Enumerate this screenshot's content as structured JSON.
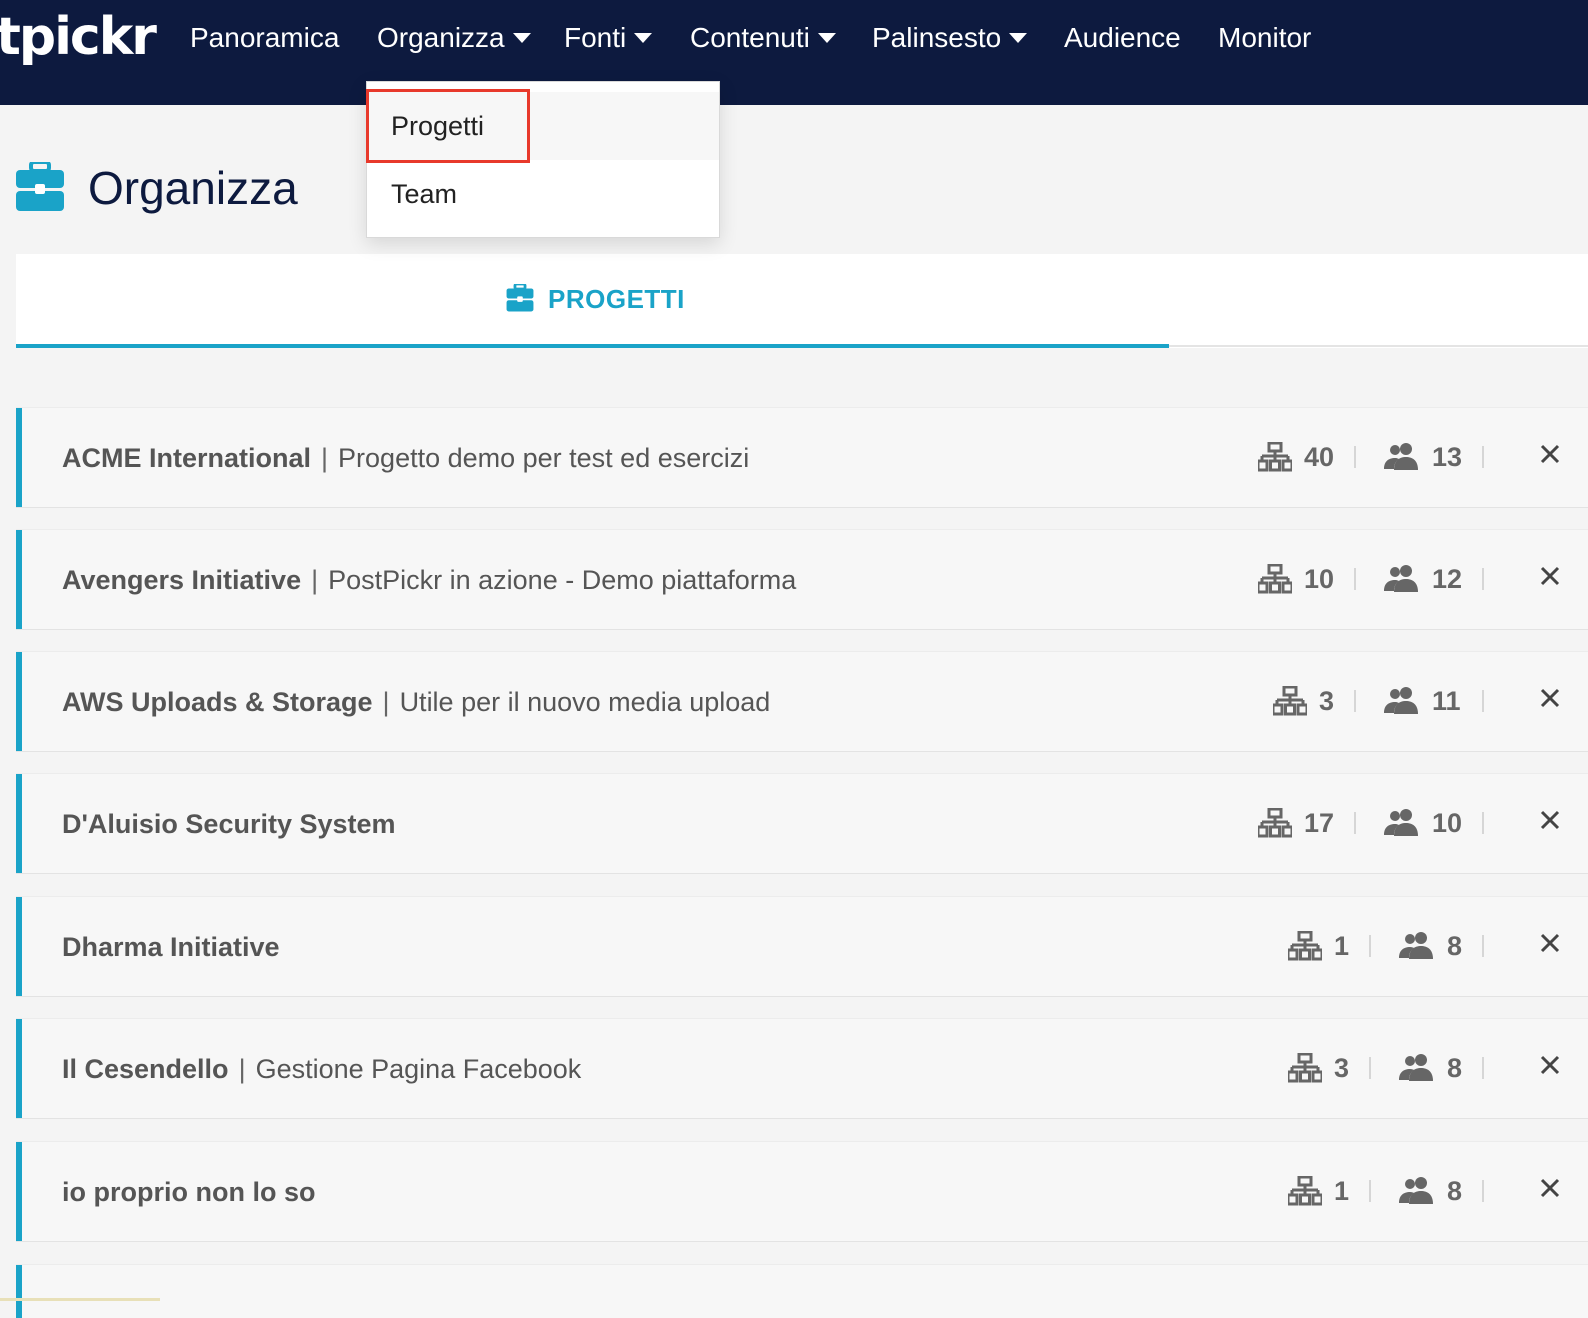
{
  "nav": {
    "logo": "tpickr",
    "items": [
      {
        "label": "Panoramica",
        "dropdown": false
      },
      {
        "label": "Organizza",
        "dropdown": true
      },
      {
        "label": "Fonti",
        "dropdown": true
      },
      {
        "label": "Contenuti",
        "dropdown": true
      },
      {
        "label": "Palinsesto",
        "dropdown": true
      },
      {
        "label": "Audience",
        "dropdown": false
      },
      {
        "label": "Monitor",
        "dropdown": false
      }
    ]
  },
  "dropdown": {
    "items": [
      "Progetti",
      "Team"
    ],
    "highlighted": "Progetti"
  },
  "page": {
    "title": "Organizza",
    "icon": "briefcase-icon"
  },
  "tabs": [
    {
      "label": "PROGETTI",
      "icon": "briefcase-icon",
      "active": true
    }
  ],
  "projects": [
    {
      "name": "ACME International",
      "description": "Progetto demo per test ed esercizi",
      "sources": "40",
      "members": "13"
    },
    {
      "name": "Avengers Initiative",
      "description": "PostPickr in azione - Demo piattaforma",
      "sources": "10",
      "members": "12"
    },
    {
      "name": "AWS Uploads & Storage",
      "description": "Utile per il nuovo media upload",
      "sources": "3",
      "members": "11"
    },
    {
      "name": "D'Aluisio Security System",
      "description": "",
      "sources": "17",
      "members": "10"
    },
    {
      "name": "Dharma Initiative",
      "description": "",
      "sources": "1",
      "members": "8"
    },
    {
      "name": "Il Cesendello",
      "description": "Gestione Pagina Facebook",
      "sources": "3",
      "members": "8"
    },
    {
      "name": "io proprio non lo so",
      "description": "",
      "sources": "1",
      "members": "8"
    }
  ],
  "colors": {
    "navbar": "#0d1a3f",
    "accent": "#1aa3c8",
    "highlight": "#e8392b"
  }
}
